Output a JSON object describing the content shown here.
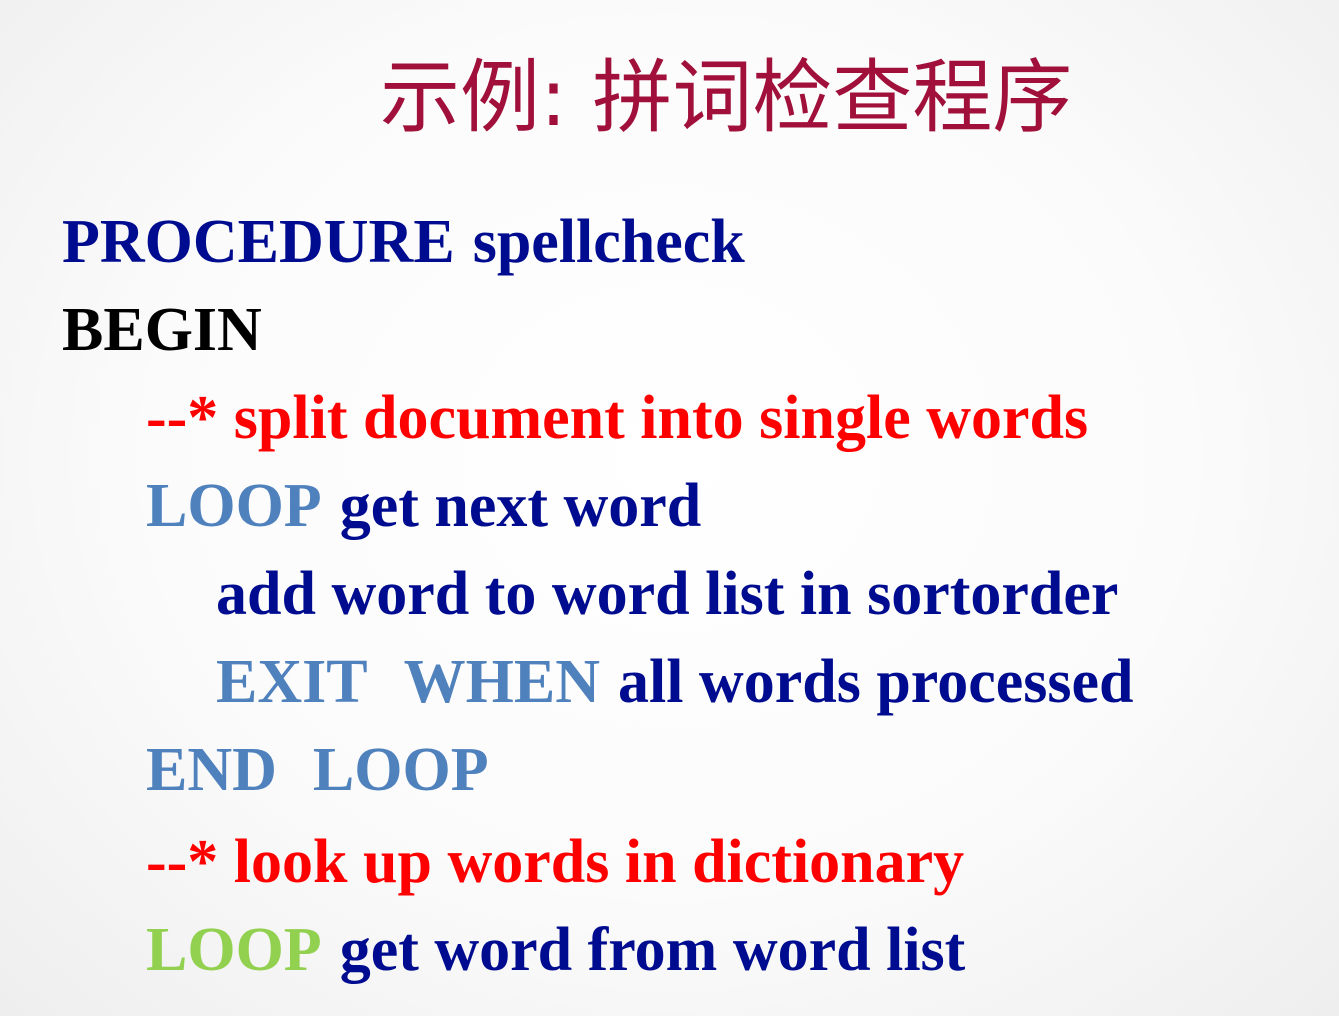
{
  "title": "示例: 拼词检查程序",
  "code": {
    "line1": {
      "keyword": "PROCEDURE",
      "text": "spellcheck"
    },
    "line2": {
      "keyword": "BEGIN"
    },
    "line3": {
      "comment": "--* split document into single words"
    },
    "line4": {
      "keyword": "LOOP",
      "text": "get next word"
    },
    "line5": {
      "text": "add word to word list in sortorder"
    },
    "line6": {
      "keyword1": "EXIT",
      "keyword2": "WHEN",
      "text": "all words processed"
    },
    "line7": {
      "keyword1": "END",
      "keyword2": "LOOP"
    },
    "line8": {
      "comment": "--* look up words in dictionary"
    },
    "line9": {
      "keyword": "LOOP",
      "text": "get word from word list"
    }
  },
  "colors": {
    "title": "#a0103a",
    "text": "#000c8f",
    "begin": "#000000",
    "comment": "#ff0000",
    "keyword": "#4f81bd",
    "keyword_highlight": "#92d050"
  }
}
